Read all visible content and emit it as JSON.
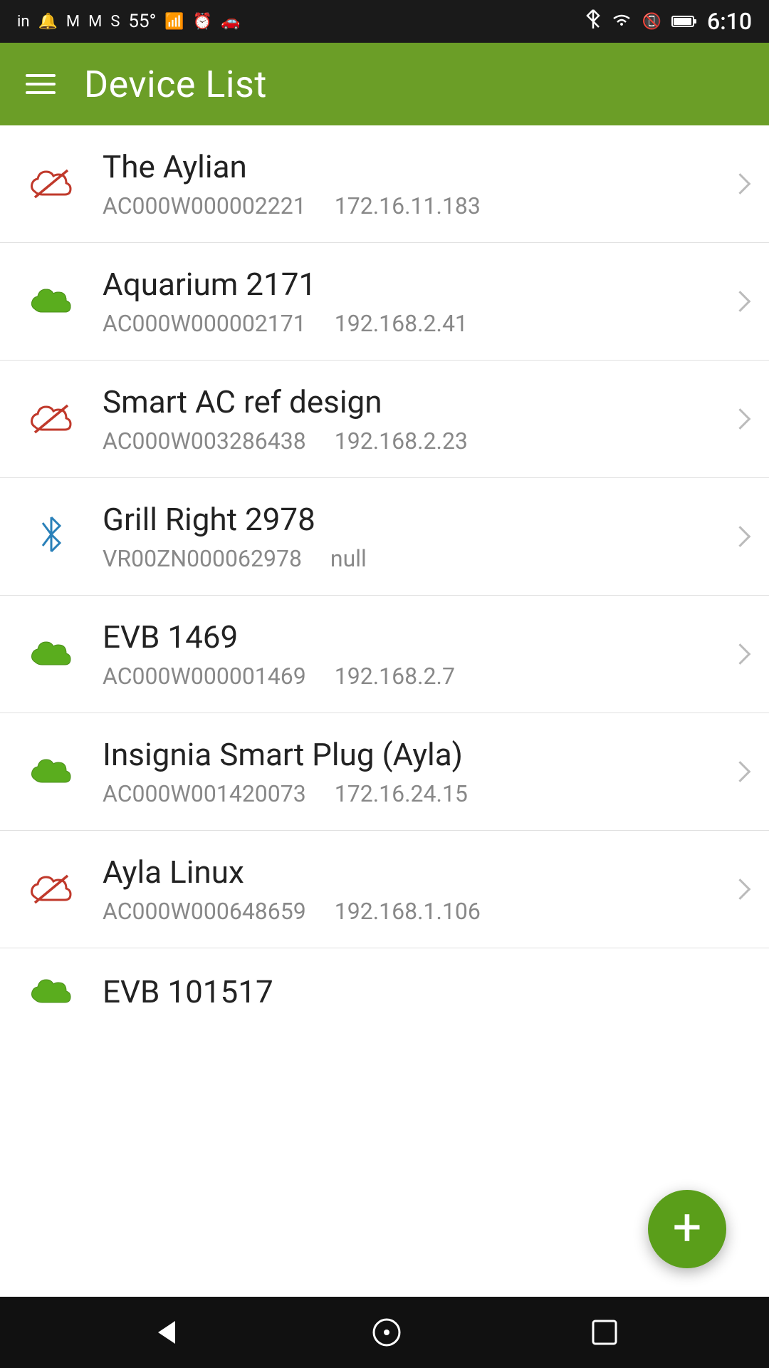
{
  "statusBar": {
    "time": "6:10",
    "temp": "55°"
  },
  "appBar": {
    "title": "Device List",
    "menuIcon": "menu"
  },
  "devices": [
    {
      "id": "device-1",
      "name": "The Aylian",
      "serial": "AC000W000002221",
      "ip": "172.16.11.183",
      "connectionType": "offline"
    },
    {
      "id": "device-2",
      "name": "Aquarium 2171",
      "serial": "AC000W000002171",
      "ip": "192.168.2.41",
      "connectionType": "online"
    },
    {
      "id": "device-3",
      "name": "Smart AC ref design",
      "serial": "AC000W003286438",
      "ip": "192.168.2.23",
      "connectionType": "offline"
    },
    {
      "id": "device-4",
      "name": "Grill Right 2978",
      "serial": "VR00ZN000062978",
      "ip": "null",
      "connectionType": "bluetooth"
    },
    {
      "id": "device-5",
      "name": "EVB 1469",
      "serial": "AC000W000001469",
      "ip": "192.168.2.7",
      "connectionType": "online"
    },
    {
      "id": "device-6",
      "name": "Insignia Smart Plug (Ayla)",
      "serial": "AC000W001420073",
      "ip": "172.16.24.15",
      "connectionType": "online"
    },
    {
      "id": "device-7",
      "name": "Ayla Linux",
      "serial": "AC000W000648659",
      "ip": "192.168.1.106",
      "connectionType": "offline"
    },
    {
      "id": "device-8",
      "name": "EVB 101517",
      "serial": "",
      "ip": "",
      "connectionType": "online"
    }
  ],
  "fab": {
    "label": "+"
  },
  "nav": {
    "back": "◀",
    "home": "○",
    "recents": "□"
  }
}
